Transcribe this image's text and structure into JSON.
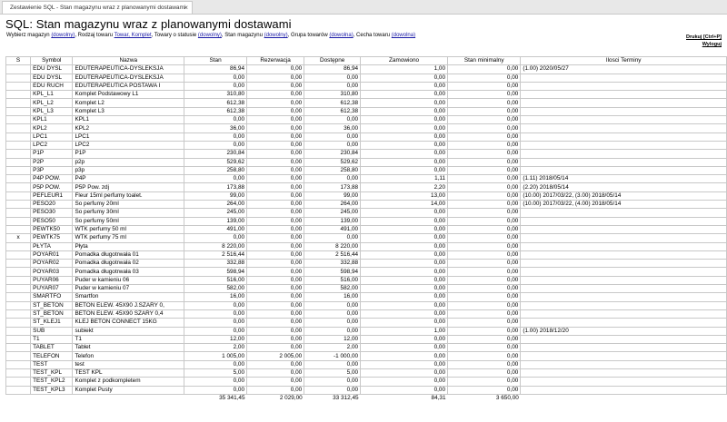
{
  "tab": {
    "title": "Zestawienie SQL - Stan magazynu wraz z planowanymi dostawami",
    "close": "×"
  },
  "page_title": "SQL: Stan magazynu wraz z planowanymi dostawami",
  "filters": {
    "magazyn_label": "Wybierz magazyn",
    "magazyn_value": "(dowolny)",
    "rodzaj_label": "Rodzaj towaru",
    "rodzaj_value": "Towar, Komplet",
    "status_label": "Towary o statusie",
    "status_value": "(dowolny)",
    "stan_label": "Stan magazynu",
    "stan_value": "(dowolny)",
    "grupa_label": "Grupa towarów",
    "grupa_value": "(dowolna)",
    "cecha_label": "Cecha towaru",
    "cecha_value": "(dowolna)"
  },
  "actions": {
    "print": "Drukuj [Ctrl+P]",
    "logout": "Wyloguj"
  },
  "columns": [
    "S",
    "Symbol",
    "Nazwa",
    "Stan",
    "Rezerwacja",
    "Dostępne",
    "Zamowiono",
    "Stan minimalny",
    "Ilosci Terminy"
  ],
  "rows": [
    [
      "",
      "EDU DYSL",
      "EDUTERAPEUTICA-DYSLEKSJA",
      "86,94",
      "0,00",
      "86,94",
      "1,00",
      "0,00",
      "(1.00) 2020/05/27"
    ],
    [
      "",
      "EDU DYSL",
      "EDUTERAPEUTICA-DYSLEKSJA",
      "0,00",
      "0,00",
      "0,00",
      "0,00",
      "0,00",
      ""
    ],
    [
      "",
      "EDU RUCH",
      "EDUTERAPEUTICA POSTAWA I",
      "0,00",
      "0,00",
      "0,00",
      "0,00",
      "0,00",
      ""
    ],
    [
      "",
      "KPL_L1",
      "Komplet Podstawowy L1",
      "310,80",
      "0,00",
      "310,80",
      "0,00",
      "0,00",
      ""
    ],
    [
      "",
      "KPL_L2",
      "Komplet L2",
      "612,38",
      "0,00",
      "612,38",
      "0,00",
      "0,00",
      ""
    ],
    [
      "",
      "KPL_L3",
      "Komplet L3",
      "612,38",
      "0,00",
      "612,38",
      "0,00",
      "0,00",
      ""
    ],
    [
      "",
      "KPL1",
      "KPL1",
      "0,00",
      "0,00",
      "0,00",
      "0,00",
      "0,00",
      ""
    ],
    [
      "",
      "KPL2",
      "KPL2",
      "36,00",
      "0,00",
      "36,00",
      "0,00",
      "0,00",
      ""
    ],
    [
      "",
      "LPC1",
      "LPC1",
      "0,00",
      "0,00",
      "0,00",
      "0,00",
      "0,00",
      ""
    ],
    [
      "",
      "LPC2",
      "LPC2",
      "0,00",
      "0,00",
      "0,00",
      "0,00",
      "0,00",
      ""
    ],
    [
      "",
      "P1P",
      "P1P",
      "230,84",
      "0,00",
      "230,84",
      "0,00",
      "0,00",
      ""
    ],
    [
      "",
      "P2P",
      "p2p",
      "529,62",
      "0,00",
      "529,62",
      "0,00",
      "0,00",
      ""
    ],
    [
      "",
      "P3P",
      "p3p",
      "258,80",
      "0,00",
      "258,80",
      "0,00",
      "0,00",
      ""
    ],
    [
      "",
      "P4P POW.",
      "P4P",
      "0,00",
      "0,00",
      "0,00",
      "1,11",
      "0,00",
      "(1.11) 2018/05/14"
    ],
    [
      "",
      "P5P POW.",
      "P5P Pow. zdj",
      "173,88",
      "0,00",
      "173,88",
      "2,20",
      "0,00",
      "(2.20) 2018/05/14"
    ],
    [
      "",
      "PEFLEUR1",
      "Fleur 15ml perfumy toalet.",
      "99,00",
      "0,00",
      "99,00",
      "13,00",
      "0,00",
      "(10.00) 2017/03/22, (3.00) 2018/05/14"
    ],
    [
      "",
      "PESO20",
      "So perfumy 20ml",
      "264,00",
      "0,00",
      "264,00",
      "14,00",
      "0,00",
      "(10.00) 2017/03/22, (4.00) 2018/05/14"
    ],
    [
      "",
      "PESO30",
      "So perfumy 30ml",
      "245,00",
      "0,00",
      "245,00",
      "0,00",
      "0,00",
      ""
    ],
    [
      "",
      "PESO50",
      "So perfumy 50ml",
      "139,00",
      "0,00",
      "139,00",
      "0,00",
      "0,00",
      ""
    ],
    [
      "",
      "PEWTK50",
      "WTK perfumy 50 ml",
      "491,00",
      "0,00",
      "491,00",
      "0,00",
      "0,00",
      ""
    ],
    [
      "x",
      "PEWTK75",
      "WTK perfumy 75 ml",
      "0,00",
      "0,00",
      "0,00",
      "0,00",
      "0,00",
      ""
    ],
    [
      "",
      "PŁYTA",
      "Płyta",
      "8 220,00",
      "0,00",
      "8 220,00",
      "0,00",
      "0,00",
      ""
    ],
    [
      "",
      "POYAR01",
      "Pomadka długotrwała 01",
      "2 516,44",
      "0,00",
      "2 516,44",
      "0,00",
      "0,00",
      ""
    ],
    [
      "",
      "POYAR02",
      "Pomadka długotrwała 02",
      "332,88",
      "0,00",
      "332,88",
      "0,00",
      "0,00",
      ""
    ],
    [
      "",
      "POYAR03",
      "Pomadka długotrwała 03",
      "598,94",
      "0,00",
      "598,94",
      "0,00",
      "0,00",
      ""
    ],
    [
      "",
      "PUYAR06",
      "Puder w kamieniu 06",
      "516,00",
      "0,00",
      "516,00",
      "0,00",
      "0,00",
      ""
    ],
    [
      "",
      "PUYAR07",
      "Puder w kamieniu 07",
      "582,00",
      "0,00",
      "582,00",
      "0,00",
      "0,00",
      ""
    ],
    [
      "",
      "SMARTFO",
      "Smartfon",
      "16,00",
      "0,00",
      "16,00",
      "0,00",
      "0,00",
      ""
    ],
    [
      "",
      "ST_BETON",
      "BETON ELEW. 45X90 J.SZARY 0,",
      "0,00",
      "0,00",
      "0,00",
      "0,00",
      "0,00",
      ""
    ],
    [
      "",
      "ST_BETON",
      "BETON ELEW. 45X90 SZARY 0,4",
      "0,00",
      "0,00",
      "0,00",
      "0,00",
      "0,00",
      ""
    ],
    [
      "",
      "ST_KLEJ1",
      "KLEJ BETON CONNECT 15KG",
      "0,00",
      "0,00",
      "0,00",
      "0,00",
      "0,00",
      ""
    ],
    [
      "",
      "SUB",
      "subiekt",
      "0,00",
      "0,00",
      "0,00",
      "1,00",
      "0,00",
      "(1.00) 2018/12/20"
    ],
    [
      "",
      "T1",
      "T1",
      "12,00",
      "0,00",
      "12,00",
      "0,00",
      "0,00",
      ""
    ],
    [
      "",
      "TABLET",
      "Tablet",
      "2,00",
      "0,00",
      "2,00",
      "0,00",
      "0,00",
      ""
    ],
    [
      "",
      "TELEFON",
      "Telefon",
      "1 005,00",
      "2 005,00",
      "-1 000,00",
      "0,00",
      "0,00",
      ""
    ],
    [
      "",
      "TEST",
      "test",
      "0,00",
      "0,00",
      "0,00",
      "0,00",
      "0,00",
      ""
    ],
    [
      "",
      "TEST_KPL",
      "TEST KPL",
      "5,00",
      "0,00",
      "5,00",
      "0,00",
      "0,00",
      ""
    ],
    [
      "",
      "TEST_KPL2",
      "Komplet z podkompletem",
      "0,00",
      "0,00",
      "0,00",
      "0,00",
      "0,00",
      ""
    ],
    [
      "",
      "TEST_KPL3",
      "Komplet Pusty",
      "0,00",
      "0,00",
      "0,00",
      "0,00",
      "0,00",
      ""
    ]
  ],
  "totals": [
    "",
    "",
    "",
    "35 341,45",
    "2 029,00",
    "33 312,45",
    "84,31",
    "3 650,00",
    ""
  ]
}
